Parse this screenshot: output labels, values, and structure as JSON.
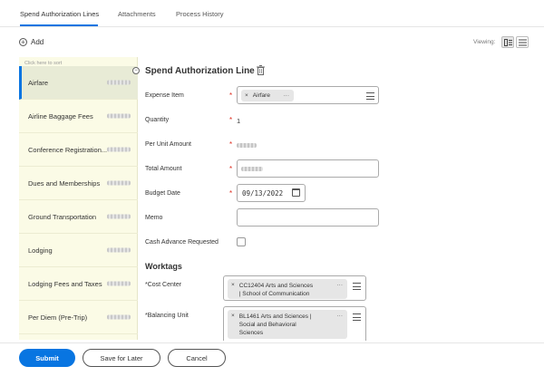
{
  "tabs": [
    {
      "label": "Spend Authorization Lines",
      "active": true
    },
    {
      "label": "Attachments",
      "active": false
    },
    {
      "label": "Process History",
      "active": false
    }
  ],
  "toolbar": {
    "add_label": "Add",
    "viewing_label": "Viewing:"
  },
  "left_list": {
    "sort_hint": "Click here to sort",
    "items": [
      {
        "label": "Airfare",
        "selected": true
      },
      {
        "label": "Airline Baggage Fees",
        "selected": false
      },
      {
        "label": "Conference Registration...",
        "selected": false
      },
      {
        "label": "Dues and Memberships",
        "selected": false
      },
      {
        "label": "Ground Transportation",
        "selected": false
      },
      {
        "label": "Lodging",
        "selected": false
      },
      {
        "label": "Lodging Fees and Taxes",
        "selected": false
      },
      {
        "label": "Per Diem (Pre-Trip)",
        "selected": false
      }
    ]
  },
  "detail": {
    "title": "Spend Authorization Line",
    "fields": {
      "expense_item": {
        "label": "Expense Item",
        "value": "Airfare",
        "required": true
      },
      "quantity": {
        "label": "Quantity",
        "value": "1",
        "required": true
      },
      "per_unit_amount": {
        "label": "Per Unit Amount",
        "required": true
      },
      "total_amount": {
        "label": "Total Amount",
        "required": true
      },
      "budget_date": {
        "label": "Budget Date",
        "value": "09/13/2022",
        "required": true
      },
      "memo": {
        "label": "Memo",
        "value": ""
      },
      "cash_advance": {
        "label": "Cash Advance Requested",
        "checked": false
      }
    },
    "worktags": {
      "heading": "Worktags",
      "cost_center": {
        "label": "*Cost Center",
        "value_line1": "CC12404 Arts and Sciences",
        "value_line2": "| School of Communication"
      },
      "balancing_unit": {
        "label": "*Balancing Unit",
        "value_line1": "BL1461 Arts and Sciences |",
        "value_line2": "Social and Behavioral",
        "value_line3": "Sciences"
      }
    }
  },
  "footer": {
    "submit_label": "Submit",
    "save_later_label": "Save for Later",
    "cancel_label": "Cancel"
  },
  "colors": {
    "accent": "#0875e1",
    "required": "#de2e21",
    "list_bg": "#fbfbe6"
  }
}
